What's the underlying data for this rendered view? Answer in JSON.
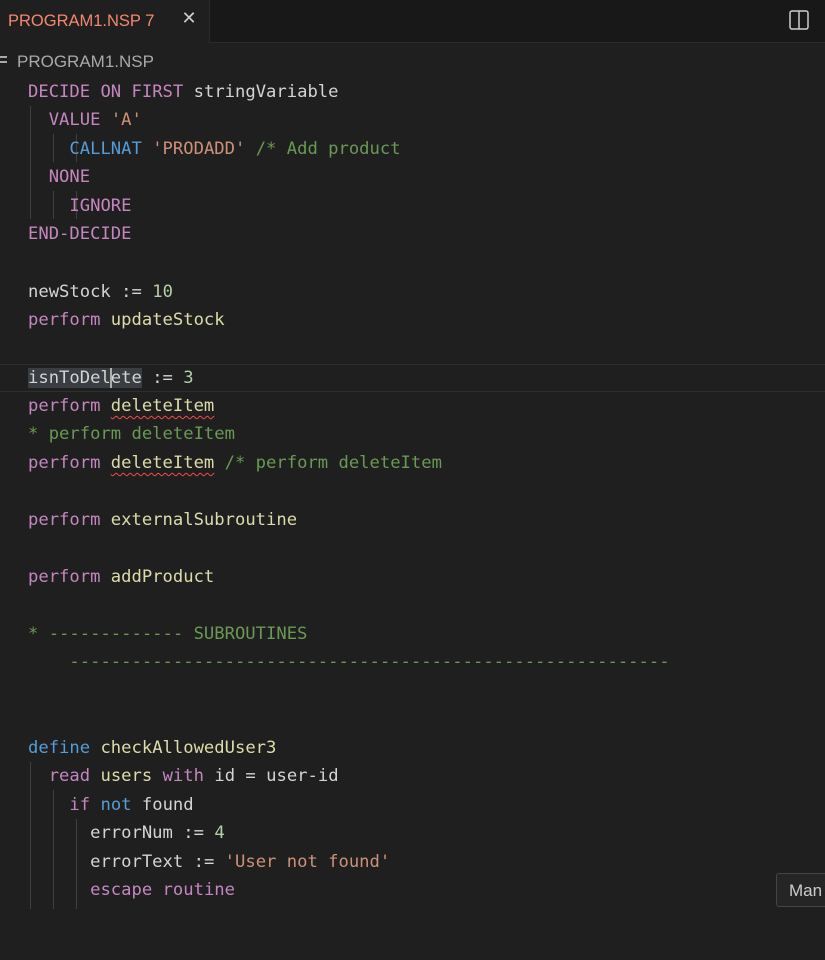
{
  "tab": {
    "title": "PROGRAM1.NSP 7",
    "close_glyph": "✕",
    "accent": "#f48771"
  },
  "breadcrumb": {
    "label": "PROGRAM1.NSP",
    "icon": "symbol-file-icon"
  },
  "toolbar": {
    "split_icon": "split-editor-icon"
  },
  "code": {
    "l1": [
      "DECIDE",
      "ON",
      "FIRST",
      "stringVariable"
    ],
    "l2": [
      "VALUE",
      "'A'"
    ],
    "l3": [
      "CALLNAT",
      "'PRODADD'",
      "/* Add product"
    ],
    "l4": [
      "NONE"
    ],
    "l5": [
      "IGNORE"
    ],
    "l6": [
      "END-DECIDE"
    ],
    "l8": [
      "newStock",
      ":=",
      "10"
    ],
    "l9": [
      "perform",
      "updateStock"
    ],
    "l11": [
      "isnToDel",
      "ete",
      ":=",
      "3"
    ],
    "l12": [
      "perform",
      "deleteItem"
    ],
    "l13": [
      "* perform deleteItem"
    ],
    "l14": [
      "perform",
      "deleteItem",
      "/* perform deleteItem"
    ],
    "l16": [
      "perform",
      "externalSubroutine"
    ],
    "l18": [
      "perform",
      "addProduct"
    ],
    "l20": [
      "* ------------- SUBROUTINES"
    ],
    "l21": [
      "----------------------------------------------------------"
    ],
    "l24": [
      "define",
      "checkAllowedUser3"
    ],
    "l25": [
      "read",
      "users",
      "with",
      "id",
      "=",
      "user-id"
    ],
    "l26": [
      "if",
      "not",
      "found"
    ],
    "l27": [
      "errorNum",
      ":=",
      "4"
    ],
    "l28": [
      "errorText",
      ":=",
      "'User not found'"
    ],
    "l29": [
      "escape",
      "routine"
    ]
  },
  "popup": {
    "label": "Man"
  }
}
